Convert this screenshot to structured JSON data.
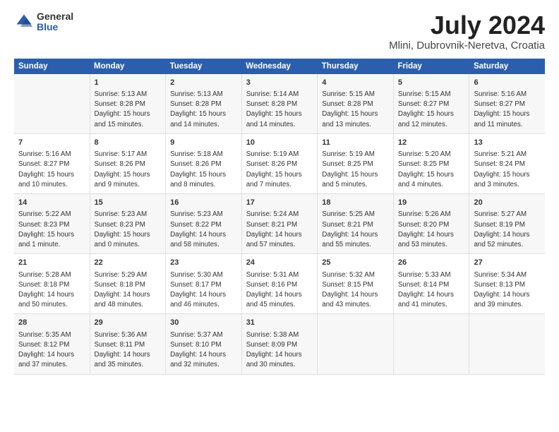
{
  "logo": {
    "general": "General",
    "blue": "Blue"
  },
  "title": "July 2024",
  "subtitle": "Mlini, Dubrovnik-Neretva, Croatia",
  "days_header": [
    "Sunday",
    "Monday",
    "Tuesday",
    "Wednesday",
    "Thursday",
    "Friday",
    "Saturday"
  ],
  "weeks": [
    [
      {
        "day": "",
        "info": ""
      },
      {
        "day": "1",
        "info": "Sunrise: 5:13 AM\nSunset: 8:28 PM\nDaylight: 15 hours\nand 15 minutes."
      },
      {
        "day": "2",
        "info": "Sunrise: 5:13 AM\nSunset: 8:28 PM\nDaylight: 15 hours\nand 14 minutes."
      },
      {
        "day": "3",
        "info": "Sunrise: 5:14 AM\nSunset: 8:28 PM\nDaylight: 15 hours\nand 14 minutes."
      },
      {
        "day": "4",
        "info": "Sunrise: 5:15 AM\nSunset: 8:28 PM\nDaylight: 15 hours\nand 13 minutes."
      },
      {
        "day": "5",
        "info": "Sunrise: 5:15 AM\nSunset: 8:27 PM\nDaylight: 15 hours\nand 12 minutes."
      },
      {
        "day": "6",
        "info": "Sunrise: 5:16 AM\nSunset: 8:27 PM\nDaylight: 15 hours\nand 11 minutes."
      }
    ],
    [
      {
        "day": "7",
        "info": "Sunrise: 5:16 AM\nSunset: 8:27 PM\nDaylight: 15 hours\nand 10 minutes."
      },
      {
        "day": "8",
        "info": "Sunrise: 5:17 AM\nSunset: 8:26 PM\nDaylight: 15 hours\nand 9 minutes."
      },
      {
        "day": "9",
        "info": "Sunrise: 5:18 AM\nSunset: 8:26 PM\nDaylight: 15 hours\nand 8 minutes."
      },
      {
        "day": "10",
        "info": "Sunrise: 5:19 AM\nSunset: 8:26 PM\nDaylight: 15 hours\nand 7 minutes."
      },
      {
        "day": "11",
        "info": "Sunrise: 5:19 AM\nSunset: 8:25 PM\nDaylight: 15 hours\nand 5 minutes."
      },
      {
        "day": "12",
        "info": "Sunrise: 5:20 AM\nSunset: 8:25 PM\nDaylight: 15 hours\nand 4 minutes."
      },
      {
        "day": "13",
        "info": "Sunrise: 5:21 AM\nSunset: 8:24 PM\nDaylight: 15 hours\nand 3 minutes."
      }
    ],
    [
      {
        "day": "14",
        "info": "Sunrise: 5:22 AM\nSunset: 8:23 PM\nDaylight: 15 hours\nand 1 minute."
      },
      {
        "day": "15",
        "info": "Sunrise: 5:23 AM\nSunset: 8:23 PM\nDaylight: 15 hours\nand 0 minutes."
      },
      {
        "day": "16",
        "info": "Sunrise: 5:23 AM\nSunset: 8:22 PM\nDaylight: 14 hours\nand 58 minutes."
      },
      {
        "day": "17",
        "info": "Sunrise: 5:24 AM\nSunset: 8:21 PM\nDaylight: 14 hours\nand 57 minutes."
      },
      {
        "day": "18",
        "info": "Sunrise: 5:25 AM\nSunset: 8:21 PM\nDaylight: 14 hours\nand 55 minutes."
      },
      {
        "day": "19",
        "info": "Sunrise: 5:26 AM\nSunset: 8:20 PM\nDaylight: 14 hours\nand 53 minutes."
      },
      {
        "day": "20",
        "info": "Sunrise: 5:27 AM\nSunset: 8:19 PM\nDaylight: 14 hours\nand 52 minutes."
      }
    ],
    [
      {
        "day": "21",
        "info": "Sunrise: 5:28 AM\nSunset: 8:18 PM\nDaylight: 14 hours\nand 50 minutes."
      },
      {
        "day": "22",
        "info": "Sunrise: 5:29 AM\nSunset: 8:18 PM\nDaylight: 14 hours\nand 48 minutes."
      },
      {
        "day": "23",
        "info": "Sunrise: 5:30 AM\nSunset: 8:17 PM\nDaylight: 14 hours\nand 46 minutes."
      },
      {
        "day": "24",
        "info": "Sunrise: 5:31 AM\nSunset: 8:16 PM\nDaylight: 14 hours\nand 45 minutes."
      },
      {
        "day": "25",
        "info": "Sunrise: 5:32 AM\nSunset: 8:15 PM\nDaylight: 14 hours\nand 43 minutes."
      },
      {
        "day": "26",
        "info": "Sunrise: 5:33 AM\nSunset: 8:14 PM\nDaylight: 14 hours\nand 41 minutes."
      },
      {
        "day": "27",
        "info": "Sunrise: 5:34 AM\nSunset: 8:13 PM\nDaylight: 14 hours\nand 39 minutes."
      }
    ],
    [
      {
        "day": "28",
        "info": "Sunrise: 5:35 AM\nSunset: 8:12 PM\nDaylight: 14 hours\nand 37 minutes."
      },
      {
        "day": "29",
        "info": "Sunrise: 5:36 AM\nSunset: 8:11 PM\nDaylight: 14 hours\nand 35 minutes."
      },
      {
        "day": "30",
        "info": "Sunrise: 5:37 AM\nSunset: 8:10 PM\nDaylight: 14 hours\nand 32 minutes."
      },
      {
        "day": "31",
        "info": "Sunrise: 5:38 AM\nSunset: 8:09 PM\nDaylight: 14 hours\nand 30 minutes."
      },
      {
        "day": "",
        "info": ""
      },
      {
        "day": "",
        "info": ""
      },
      {
        "day": "",
        "info": ""
      }
    ]
  ]
}
